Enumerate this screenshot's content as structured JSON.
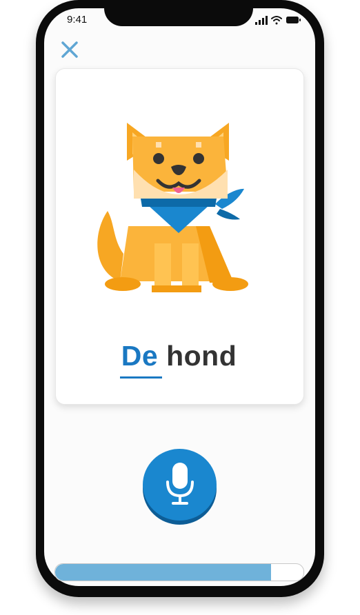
{
  "status": {
    "time": "9:41"
  },
  "header": {
    "close_icon": "close-icon"
  },
  "card": {
    "image_icon": "shiba-dog-illustration",
    "article": "De",
    "noun": "hond"
  },
  "mic": {
    "icon": "microphone-icon"
  },
  "progress": {
    "value": 0.87
  },
  "colors": {
    "accent": "#1a78c2",
    "mic": "#1a87cf",
    "progress": "#6fb2da",
    "close": "#5fa6d4"
  }
}
